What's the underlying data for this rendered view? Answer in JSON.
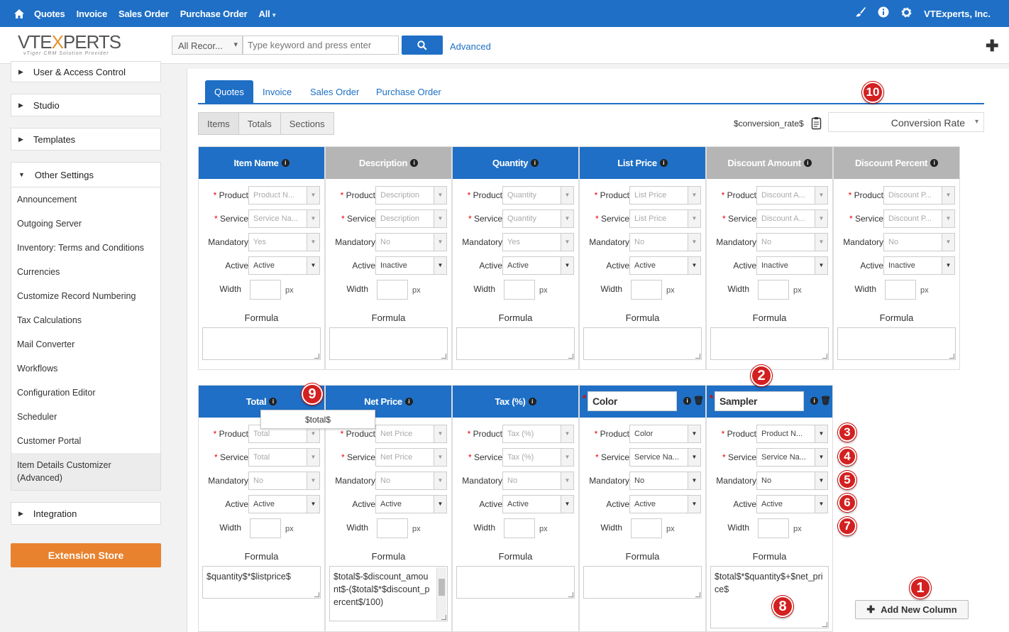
{
  "topnav": {
    "items": [
      "Quotes",
      "Invoice",
      "Sales Order",
      "Purchase Order",
      "All"
    ],
    "company": "VTExperts, Inc."
  },
  "logo": {
    "text_a": "VTE",
    "text_b": "X",
    "text_c": "PERTS",
    "tagline": "vTiger CRM Solution Provider"
  },
  "search": {
    "scope": "All Recor...",
    "placeholder": "Type keyword and press enter",
    "advanced": "Advanced"
  },
  "sidebar": {
    "sections": [
      "User & Access Control",
      "Studio",
      "Templates",
      "Other Settings"
    ],
    "items": [
      "Announcement",
      "Outgoing Server",
      "Inventory: Terms and Conditions",
      "Currencies",
      "Customize Record Numbering",
      "Tax Calculations",
      "Mail Converter",
      "Workflows",
      "Configuration Editor",
      "Scheduler",
      "Customer Portal",
      "Item Details Customizer (Advanced)"
    ],
    "integration": "Integration",
    "extension_store": "Extension Store"
  },
  "tabs": [
    "Quotes",
    "Invoice",
    "Sales Order",
    "Purchase Order"
  ],
  "subtabs": [
    "Items",
    "Totals",
    "Sections"
  ],
  "conversion": {
    "label": "$conversion_rate$",
    "select": "Conversion Rate"
  },
  "labels": {
    "product": "Product",
    "service": "Service",
    "mandatory": "Mandatory",
    "active": "Active",
    "width": "Width",
    "px": "px",
    "formula": "Formula"
  },
  "columns_row1": [
    {
      "name": "Item Name",
      "product": "Product N...",
      "service": "Service Na...",
      "mandatory": "Yes",
      "active": "Active",
      "formula": ""
    },
    {
      "name": "Description",
      "product": "Description",
      "service": "Description",
      "mandatory": "No",
      "active": "Inactive",
      "formula": ""
    },
    {
      "name": "Quantity",
      "product": "Quantity",
      "service": "Quantity",
      "mandatory": "Yes",
      "active": "Active",
      "formula": ""
    },
    {
      "name": "List Price",
      "product": "List Price",
      "service": "List Price",
      "mandatory": "No",
      "active": "Active",
      "formula": ""
    },
    {
      "name": "Discount Amount",
      "product": "Discount A...",
      "service": "Discount A...",
      "mandatory": "No",
      "active": "Inactive",
      "formula": ""
    },
    {
      "name": "Discount Percent",
      "product": "Discount P...",
      "service": "Discount P...",
      "mandatory": "No",
      "active": "Inactive",
      "formula": ""
    }
  ],
  "columns_row2": [
    {
      "name": "Total",
      "product": "Total",
      "service": "Total",
      "mandatory": "No",
      "active": "Active",
      "formula": "$quantity$*$listprice$"
    },
    {
      "name": "Net Price",
      "product": "Net Price",
      "service": "Net Price",
      "mandatory": "No",
      "active": "Active",
      "formula": "$total$-$discount_amount$-($total$*$discount_percent$/100)"
    },
    {
      "name": "Tax (%)",
      "product": "Tax (%)",
      "service": "Tax (%)",
      "mandatory": "No",
      "active": "Active",
      "formula": ""
    },
    {
      "name": "Color",
      "product": "Color",
      "service": "Service Na...",
      "mandatory": "No",
      "active": "Active",
      "formula": ""
    },
    {
      "name": "Sampler",
      "product": "Product N...",
      "service": "Service Na...",
      "mandatory": "No",
      "active": "Active",
      "formula": "$total$*$quantity$+$net_price$"
    }
  ],
  "tooltip": "$total$",
  "add_column": "Add New Column",
  "badges": [
    "1",
    "2",
    "3",
    "4",
    "5",
    "6",
    "7",
    "8",
    "9",
    "10"
  ],
  "colors": {
    "brand_blue": "#1e6fc5",
    "header_grey": "#b5b5b5",
    "orange": "#e8822e",
    "badge_red": "#d32020"
  }
}
